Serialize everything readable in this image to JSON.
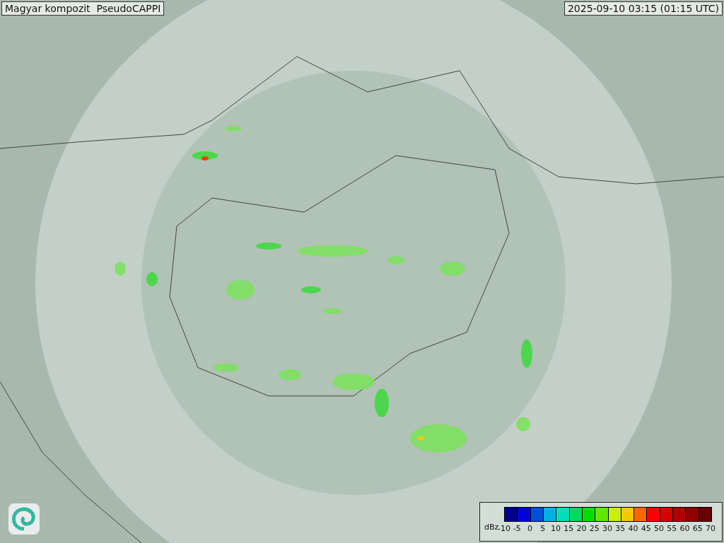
{
  "title": "Magyar kompozit  PseudoCAPPI",
  "timestamp": "2025-09-10 03:15 (01:15 UTC)",
  "legend": {
    "unit": "dBz",
    "bins": [
      {
        "color": "#000090"
      },
      {
        "color": "#0000d8"
      },
      {
        "color": "#0050d8"
      },
      {
        "color": "#00b0e0"
      },
      {
        "color": "#00e0b8"
      },
      {
        "color": "#00d860"
      },
      {
        "color": "#00e000"
      },
      {
        "color": "#60e800"
      },
      {
        "color": "#c8f000"
      },
      {
        "color": "#f8c800"
      },
      {
        "color": "#ff6800"
      },
      {
        "color": "#ff0000"
      },
      {
        "color": "#d80000"
      },
      {
        "color": "#b00000"
      },
      {
        "color": "#900000"
      },
      {
        "color": "#680000"
      }
    ],
    "ticks": [
      "-10",
      "-5",
      "0",
      "5",
      "10",
      "15",
      "20",
      "25",
      "30",
      "35",
      "40",
      "45",
      "50",
      "55",
      "60",
      "65",
      "70"
    ]
  }
}
